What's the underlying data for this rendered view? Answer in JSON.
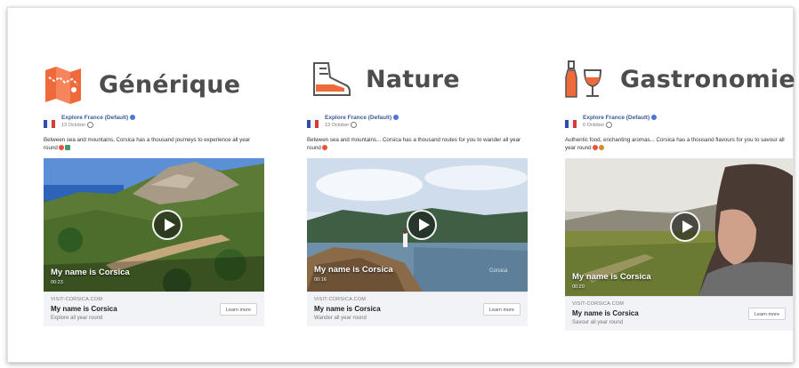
{
  "categories": [
    {
      "title": "Générique",
      "icon": "map-icon"
    },
    {
      "title": "Nature",
      "icon": "hiking-boot-icon"
    },
    {
      "title": "Gastronomie",
      "icon": "wine-glass-icon"
    }
  ],
  "posts": [
    {
      "page_name": "Explore France (Default)",
      "date": "13 October",
      "text": "Between sea and mountains, Corsica has a thousand journeys to experience all year round",
      "video_title": "My name is Corsica",
      "video_time": "00:23",
      "domain": "VISIT-CORSICA.COM",
      "headline": "My name is Corsica",
      "description": "Explore all year round",
      "button": "Learn more"
    },
    {
      "page_name": "Explore France (Default)",
      "date": "13 October",
      "text": "Between sea and mountains... Corsica has a thousand routes for you to wander all year round",
      "video_title": "My name is Corsica",
      "video_time": "00:16",
      "watermark": "Corsica",
      "domain": "VISIT-CORSICA.COM",
      "headline": "My name is Corsica",
      "description": "Wander all year round",
      "button": "Learn more"
    },
    {
      "page_name": "Explore France (Default)",
      "date": "6 October",
      "text": "Authentic food, enchanting aromas... Corsica has a thousand flavours for you to savour all year round",
      "video_title": "My name is Corsica",
      "video_time": "00:20",
      "domain": "VISIT-CORSICA.COM",
      "headline": "My name is Corsica",
      "description": "Savour all year round",
      "button": "Learn more"
    }
  ],
  "colors": {
    "icon_accent": "#ef6a3a",
    "title_gray": "#4d4d4d",
    "page_link": "#3b5998"
  }
}
